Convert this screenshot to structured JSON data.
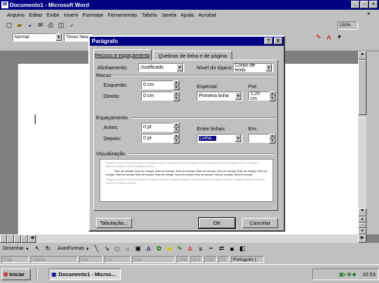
{
  "app": {
    "title": "Documento1 - Microsoft Word",
    "menu": [
      "Arquivo",
      "Editar",
      "Exibir",
      "Inserir",
      "Formatar",
      "Ferramentas",
      "Tabela",
      "Janela",
      "Ajuda",
      "Acrobat"
    ]
  },
  "format_bar": {
    "style": "Normal",
    "font": "Times New",
    "zoom": "100%"
  },
  "dialog": {
    "title": "Parágrafo",
    "help": "?",
    "close": "X",
    "tabs": [
      "Recuos e espaçamento",
      "Quebras de linha e de página"
    ],
    "alignment": {
      "label": "Alinhamento:",
      "value": "Justificado"
    },
    "outline": {
      "label": "Nível do tópico:",
      "value": "Corpo de texto"
    },
    "indent": {
      "title": "Recuo",
      "left_label": "Esquerdo:",
      "left_value": "0 cm",
      "right_label": "Direito:",
      "right_value": "0 cm",
      "special_label": "Especial:",
      "special_value": "Primeira linha",
      "by_label": "Por:",
      "by_value": "1,25 cm"
    },
    "spacing": {
      "title": "Espaçamento",
      "before_label": "Antes:",
      "before_value": "0 pt",
      "after_label": "Depois:",
      "after_value": "0 pt",
      "line_label": "Entre linhas:",
      "line_value": "Linha...",
      "at_label": "Em:",
      "at_value": ""
    },
    "preview": {
      "title": "Visualização",
      "prev_text": "Parágrafo anterior Parágrafo anterior Parágrafo anterior Parágrafo anterior Parágrafo anterior Parágrafo anterior Parágrafo anterior Parágrafo anterior Parágrafo anterior Parágrafo anterior",
      "sample_text": "Texto de exemplo Texto de exemplo Texto de exemplo Texto de exemplo Texto de exemplo Texto de exemplo Texto de exemplo Texto de exemplo Texto de exemplo Texto de exemplo Texto de exemplo Texto de exemplo Texto de exemplo Texto de exemplo Texto de exemplo",
      "next_text": "Parágrafo seguinte Parágrafo seguinte Parágrafo seguinte Parágrafo seguinte Parágrafo seguinte Parágrafo seguinte Parágrafo seguinte Parágrafo seguinte Parágrafo seguinte"
    },
    "tabs_button": "Tabulação...",
    "ok": "OK",
    "cancel": "Cancelar"
  },
  "drawing": {
    "label": "Desenhar",
    "autoshapes": "AutoFormas"
  },
  "status": {
    "page": "Pág",
    "section": "Seção",
    "at": "Em",
    "line": "Lin",
    "col": "Col",
    "rec": "GRA",
    "alt": "ALT",
    "est": "EST",
    "ext": "SE",
    "lang": "Português ("
  },
  "taskbar": {
    "start": "Iniciar",
    "task": "Documento1 - Micros...",
    "clock": "10:53"
  },
  "colors": {
    "titlebar": "#000080",
    "face": "#c0c0c0",
    "desktop": "#808080"
  }
}
